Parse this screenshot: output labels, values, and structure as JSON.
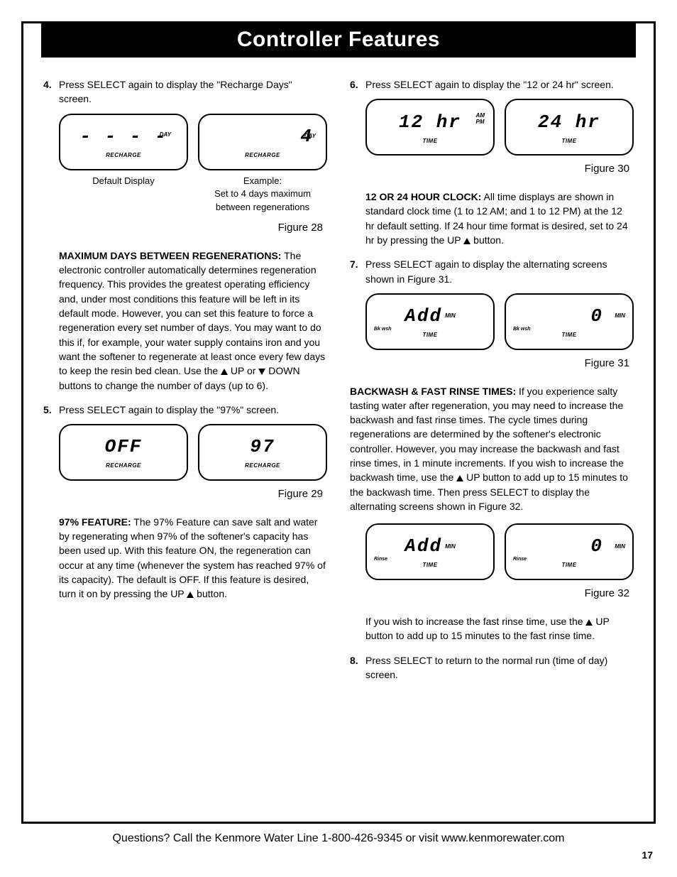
{
  "title": "Controller Features",
  "left": {
    "step4_num": "4.",
    "step4_text": "Press SELECT again to display the \"Recharge Days\" screen.",
    "fig28": {
      "lcd1_big": "- - - -",
      "lcd1_unit": "DAY",
      "lcd1_sub": "RECHARGE",
      "lcd2_big": "4",
      "lcd2_unit": "DAY",
      "lcd2_sub": "RECHARGE",
      "cap1": "Default Display",
      "cap2": "Example:",
      "cap2b": "Set to 4 days maximum between regenerations",
      "label": "Figure 28"
    },
    "para_max_b": "MAXIMUM DAYS BETWEEN REGENERATIONS:",
    "para_max": " The electronic controller automatically determines regeneration frequency. This provides the greatest operating efficiency and, under most conditions this feature will be left in its default mode. However, you can set this feature to force a regeneration every set number of days. You may want to do this if, for example, your water supply contains iron and you want the softener to regenerate at least once every few days to keep the resin bed clean. Use the ",
    "para_max_tail": " UP or ",
    "para_max_tail2": " DOWN buttons to change the number of days (up to 6).",
    "step5_num": "5.",
    "step5_text": "Press SELECT again to display the \"97%\" screen.",
    "fig29": {
      "lcd1_big": "OFF",
      "lcd1_sub": "RECHARGE",
      "lcd2_big": "97",
      "lcd2_sub": "RECHARGE",
      "label": "Figure 29"
    },
    "para97_b": "97% FEATURE:",
    "para97": " The 97% Feature can save salt and water by regenerating when 97% of the softener's capacity has been used up. With this feature ON, the regeneration can occur at any time (whenever the system has reached 97% of its capacity). The default is OFF. If this feature is desired, turn it on by pressing the UP ",
    "para97_tail": " button."
  },
  "right": {
    "step6_num": "6.",
    "step6_text": "Press SELECT again to display the \"12 or 24 hr\" screen.",
    "fig30": {
      "lcd1_big": "12 hr",
      "lcd1_unit": "AM\nPM",
      "lcd1_sub": "TIME",
      "lcd2_big": "24 hr",
      "lcd2_sub": "TIME",
      "label": "Figure 30"
    },
    "para_clock_b": "12 OR 24 HOUR CLOCK:",
    "para_clock": " All time displays are shown in standard clock time (1 to 12 AM; and 1 to 12 PM) at the 12 hr default setting. If 24 hour time format is desired, set to 24 hr by pressing the UP ",
    "para_clock_tail": " button.",
    "step7_num": "7.",
    "step7_text": "Press SELECT again to display the alternating screens shown in Figure 31.",
    "fig31": {
      "lcd1_big": "Add",
      "lcd1_unit": "MIN",
      "lcd1_left": "Bk wsh",
      "lcd1_sub": "TIME",
      "lcd2_big": "0",
      "lcd2_unit": "MIN",
      "lcd2_left": "Bk wsh",
      "lcd2_sub": "TIME",
      "label": "Figure 31"
    },
    "para_bw_b": "BACKWASH & FAST RINSE TIMES:",
    "para_bw": " If you experience salty tasting water after regeneration, you may need to increase the backwash and fast rinse times. The cycle times during regenerations are determined by the softener's electronic controller. However, you may increase the backwash and fast rinse times, in 1 minute increments. If you wish to increase the backwash time, use the ",
    "para_bw_mid": " UP button to add up to 15 minutes to the backwash time. Then press SELECT to display the alternating screens shown in Figure 32.",
    "fig32": {
      "lcd1_big": "Add",
      "lcd1_unit": "MIN",
      "lcd1_left": "Rinse",
      "lcd1_sub": "TIME",
      "lcd2_big": "0",
      "lcd2_unit": "MIN",
      "lcd2_left": "Rinse",
      "lcd2_sub": "TIME",
      "label": "Figure 32"
    },
    "para_rinse": "If you wish to increase the fast rinse time, use the ",
    "para_rinse_tail": " UP button to add up to 15 minutes to the fast rinse time.",
    "step8_num": "8.",
    "step8_text": "Press SELECT to return to the normal run (time of day) screen."
  },
  "footer": "Questions? Call the Kenmore Water Line 1-800-426-9345 or visit www.kenmorewater.com",
  "pagenum": "17"
}
